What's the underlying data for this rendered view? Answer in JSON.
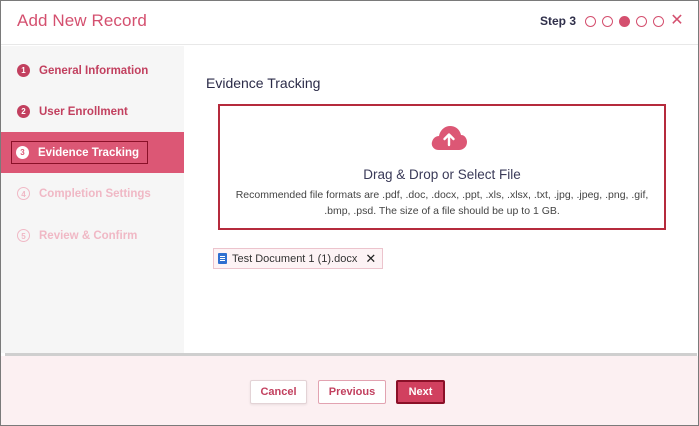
{
  "header": {
    "title": "Add New Record",
    "step_label": "Step 3",
    "steps_total": 5,
    "steps_active": 3,
    "close_icon": "close-icon"
  },
  "sidebar": {
    "items": [
      {
        "num": "1",
        "label": "General Information",
        "state": "done"
      },
      {
        "num": "2",
        "label": "User Enrollment",
        "state": "done"
      },
      {
        "num": "3",
        "label": "Evidence Tracking",
        "state": "current"
      },
      {
        "num": "4",
        "label": "Completion Settings",
        "state": "future"
      },
      {
        "num": "5",
        "label": "Review & Confirm",
        "state": "future"
      }
    ]
  },
  "main": {
    "section_title": "Evidence Tracking",
    "dropzone": {
      "icon": "cloud-upload-icon",
      "title": "Drag & Drop or Select File",
      "description": "Recommended file formats are .pdf, .doc, .docx, .ppt, .xls, .xlsx, .txt, .jpg, .jpeg, .png, .gif, .bmp, .psd. The size of a file should be up to 1 GB."
    },
    "attachment": {
      "file_name": "Test Document 1 (1).docx",
      "icon": "word-file-icon",
      "remove_symbol": "✕"
    }
  },
  "footer": {
    "cancel_label": "Cancel",
    "previous_label": "Previous",
    "next_label": "Next"
  },
  "colors": {
    "accent": "#d4506f",
    "active_step_bg": "#dc5775",
    "focus_border": "#8a1028",
    "footer_bg": "#fcf0f2"
  }
}
